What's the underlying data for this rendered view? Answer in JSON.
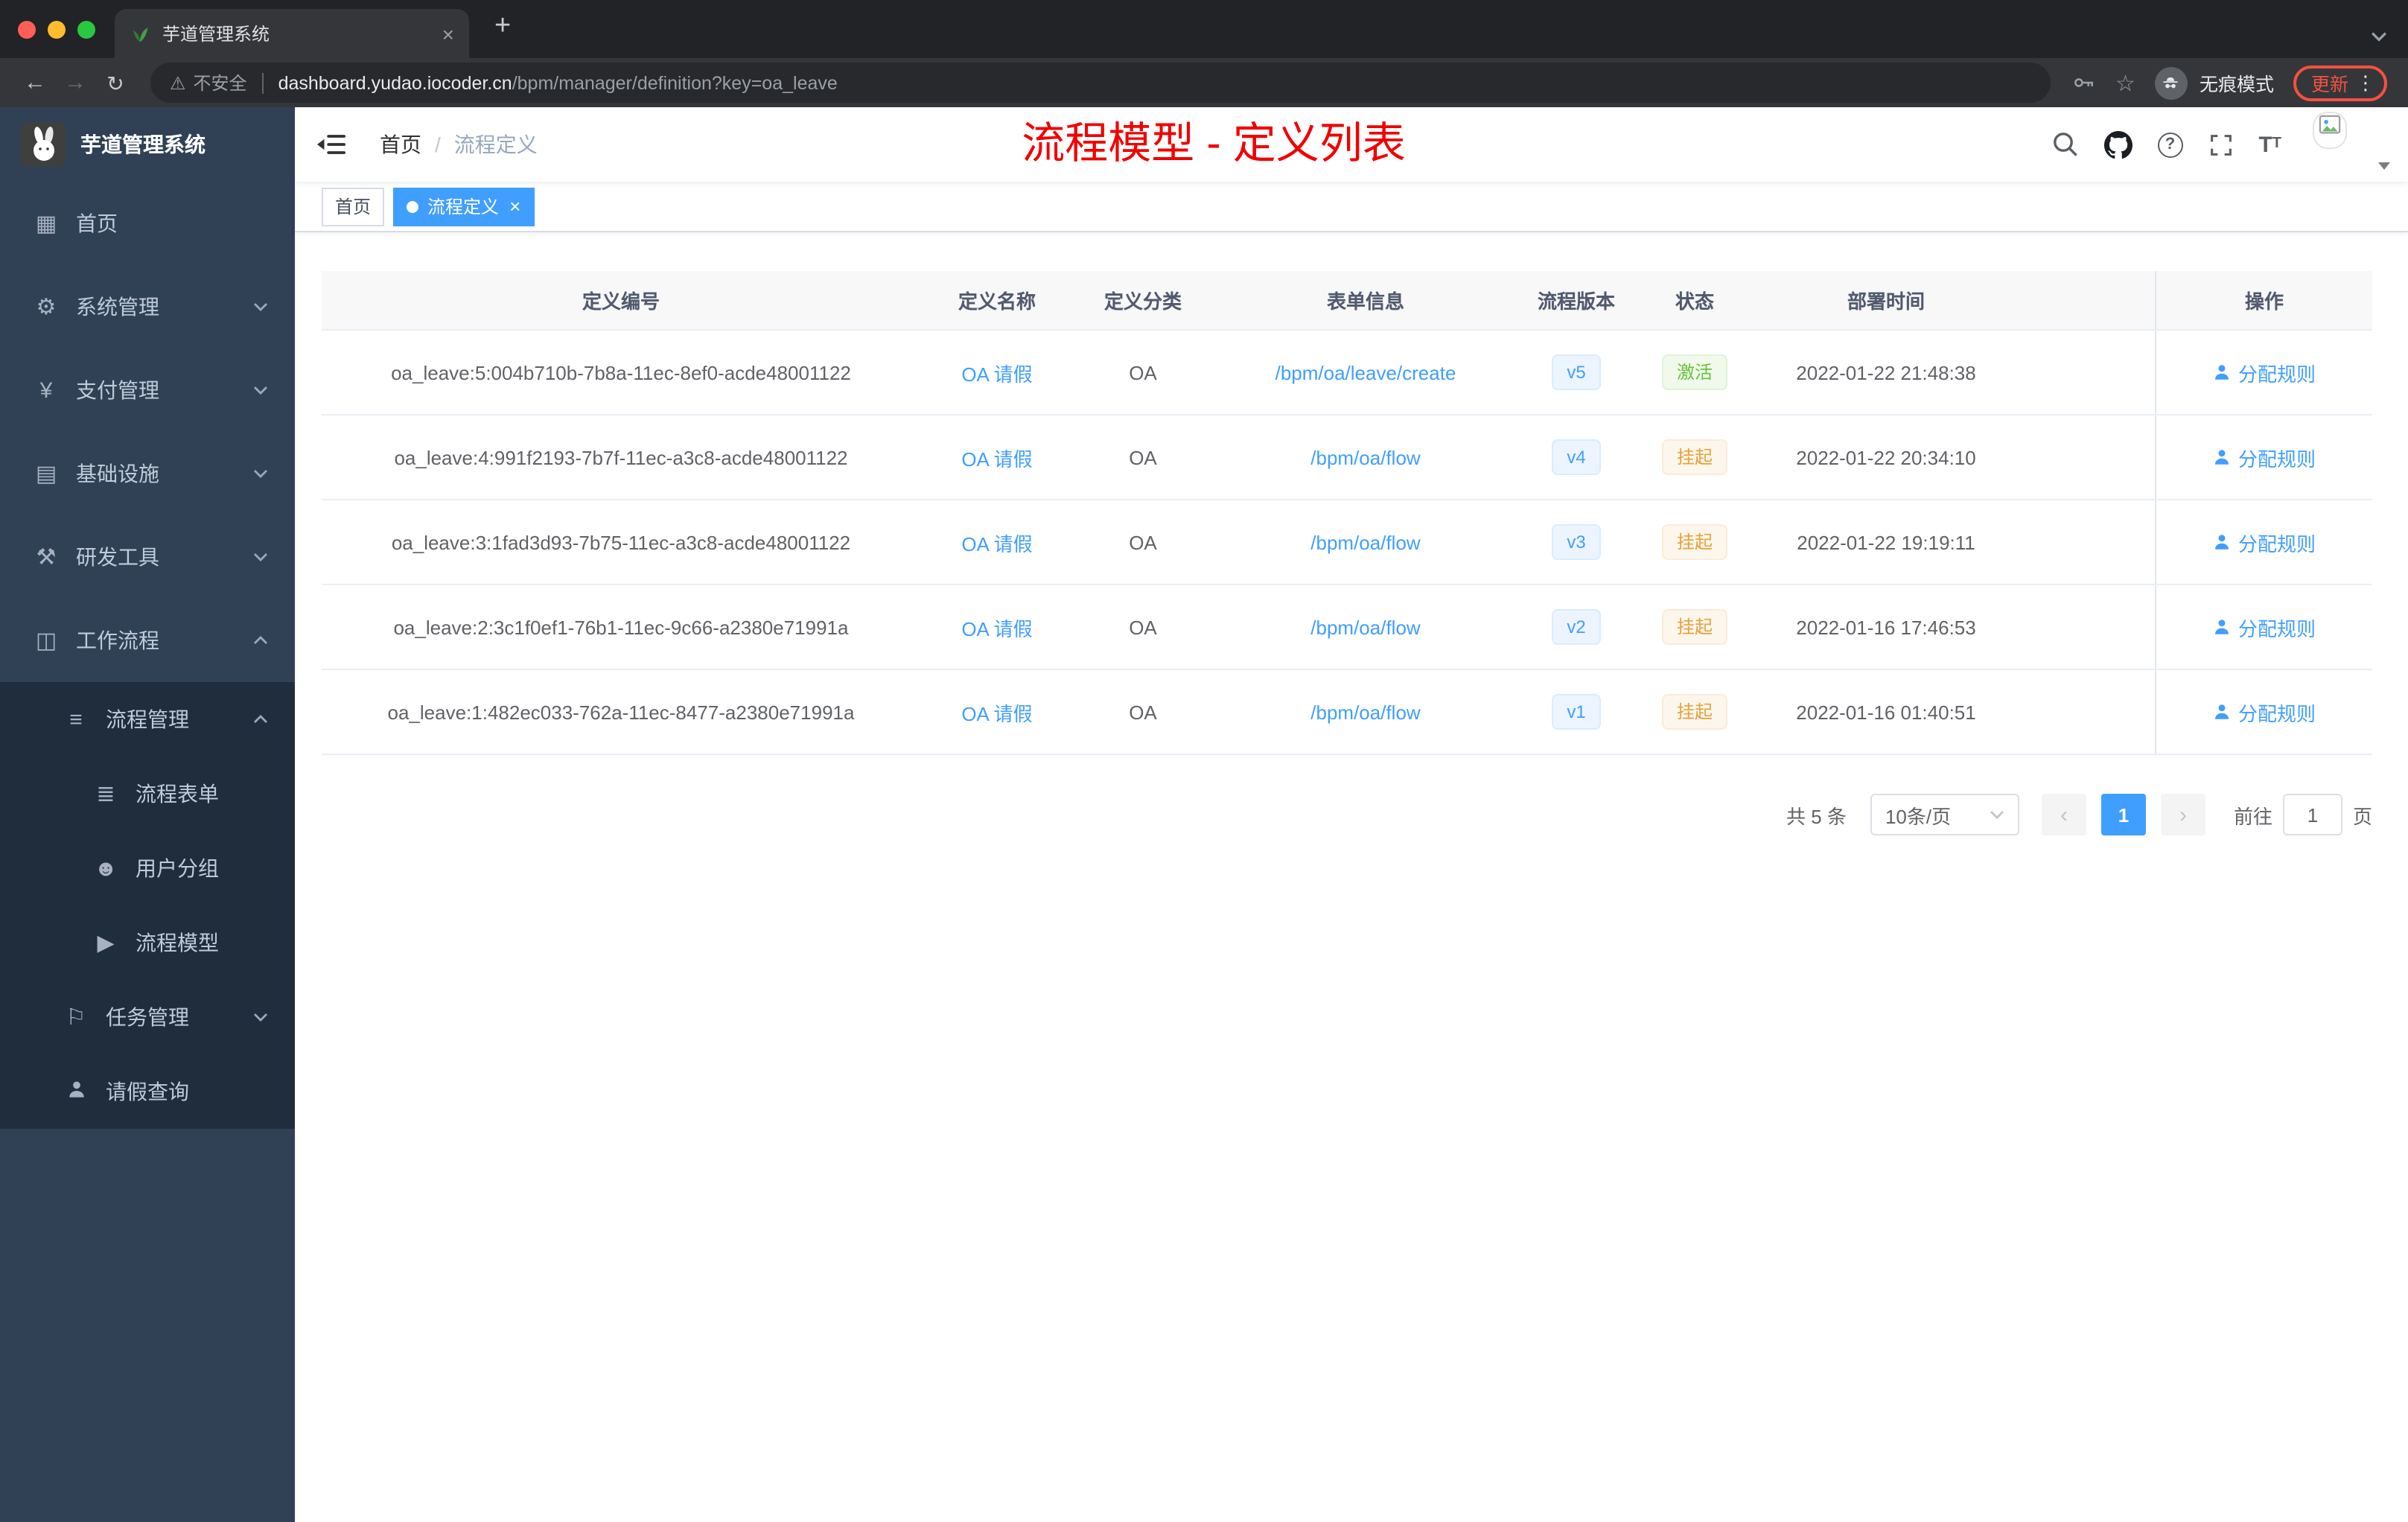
{
  "browser": {
    "tab_title": "芋道管理系统",
    "security_label": "不安全",
    "url_host": "dashboard.yudao.iocoder.cn",
    "url_path": "/bpm/manager/definition?key=oa_leave",
    "incognito_label": "无痕模式",
    "update_label": "更新"
  },
  "sidebar": {
    "logo_title": "芋道管理系统",
    "items": [
      {
        "label": "首页"
      },
      {
        "label": "系统管理"
      },
      {
        "label": "支付管理"
      },
      {
        "label": "基础设施"
      },
      {
        "label": "研发工具"
      },
      {
        "label": "工作流程"
      },
      {
        "label": "流程管理"
      },
      {
        "label": "流程表单"
      },
      {
        "label": "用户分组"
      },
      {
        "label": "流程模型"
      },
      {
        "label": "任务管理"
      },
      {
        "label": "请假查询"
      }
    ]
  },
  "navbar": {
    "breadcrumb_home": "首页",
    "breadcrumb_sep": "/",
    "breadcrumb_current": "流程定义",
    "annotation": "流程模型 - 定义列表"
  },
  "tags": [
    {
      "label": "首页"
    },
    {
      "label": "流程定义"
    }
  ],
  "table": {
    "columns": [
      "定义编号",
      "定义名称",
      "定义分类",
      "表单信息",
      "流程版本",
      "状态",
      "部署时间",
      "操作"
    ],
    "rows": [
      {
        "id": "oa_leave:5:004b710b-7b8a-11ec-8ef0-acde48001122",
        "name": "OA 请假",
        "category": "OA",
        "form": "/bpm/oa/leave/create",
        "version": "v5",
        "status": "激活",
        "status_type": "success",
        "deploy_time": "2022-01-22 21:48:38",
        "action": "分配规则"
      },
      {
        "id": "oa_leave:4:991f2193-7b7f-11ec-a3c8-acde48001122",
        "name": "OA 请假",
        "category": "OA",
        "form": "/bpm/oa/flow",
        "version": "v4",
        "status": "挂起",
        "status_type": "warning",
        "deploy_time": "2022-01-22 20:34:10",
        "action": "分配规则"
      },
      {
        "id": "oa_leave:3:1fad3d93-7b75-11ec-a3c8-acde48001122",
        "name": "OA 请假",
        "category": "OA",
        "form": "/bpm/oa/flow",
        "version": "v3",
        "status": "挂起",
        "status_type": "warning",
        "deploy_time": "2022-01-22 19:19:11",
        "action": "分配规则"
      },
      {
        "id": "oa_leave:2:3c1f0ef1-76b1-11ec-9c66-a2380e71991a",
        "name": "OA 请假",
        "category": "OA",
        "form": "/bpm/oa/flow",
        "version": "v2",
        "status": "挂起",
        "status_type": "warning",
        "deploy_time": "2022-01-16 17:46:53",
        "action": "分配规则"
      },
      {
        "id": "oa_leave:1:482ec033-762a-11ec-8477-a2380e71991a",
        "name": "OA 请假",
        "category": "OA",
        "form": "/bpm/oa/flow",
        "version": "v1",
        "status": "挂起",
        "status_type": "warning",
        "deploy_time": "2022-01-16 01:40:51",
        "action": "分配规则"
      }
    ]
  },
  "pagination": {
    "total": "共 5 条",
    "page_size": "10条/页",
    "current_page": "1",
    "goto_label": "前往",
    "goto_value": "1",
    "page_unit": "页"
  },
  "colors": {
    "accent": "#409eff",
    "annotation_red": "#f20000",
    "success": "#67c23a",
    "warning": "#e6a23c",
    "sidebar_bg": "#304156",
    "submenu_bg": "#1f2d3d"
  }
}
